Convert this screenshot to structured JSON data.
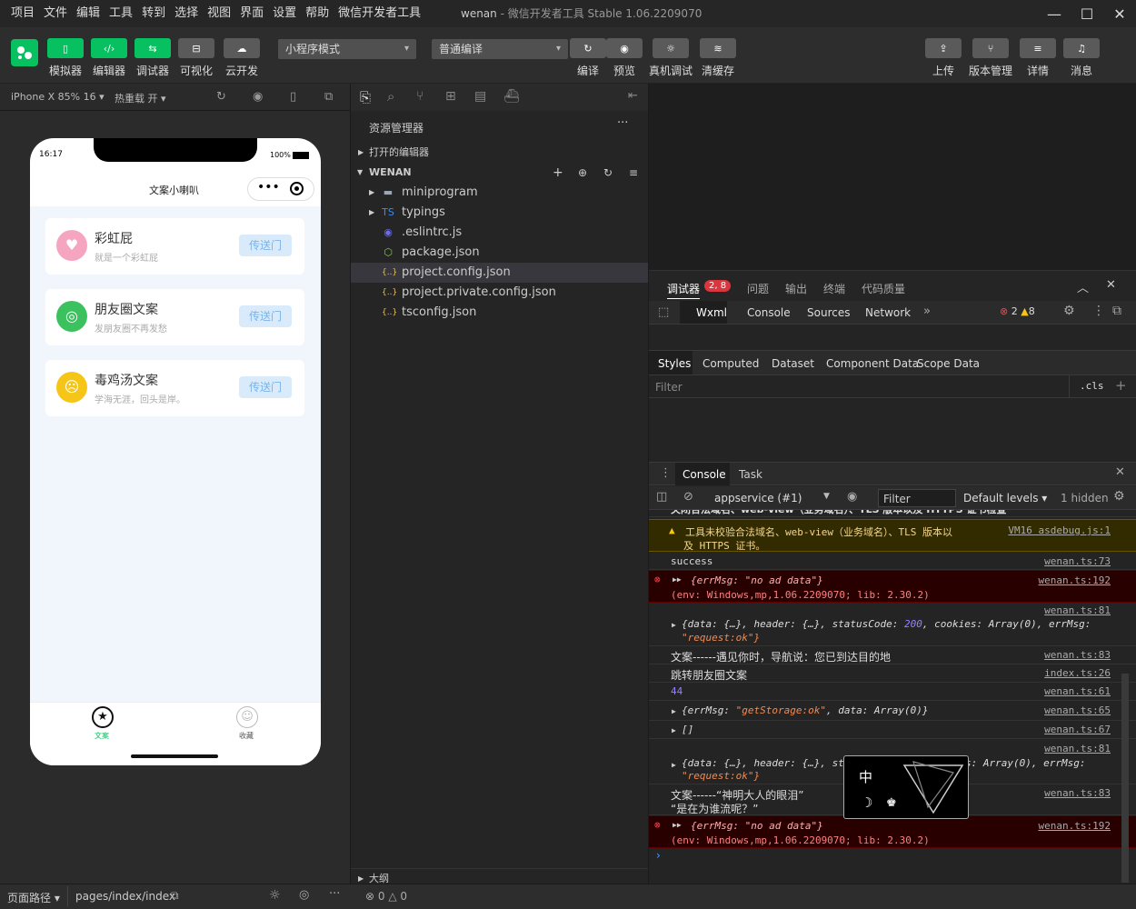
{
  "menubar": {
    "items": [
      "项目",
      "文件",
      "编辑",
      "工具",
      "转到",
      "选择",
      "视图",
      "界面",
      "设置",
      "帮助",
      "微信开发者工具"
    ],
    "title_app": "wenan",
    "title_rest": " - 微信开发者工具 Stable 1.06.2209070"
  },
  "toolbar": {
    "left": [
      {
        "label": "模拟器",
        "icon": "phone-icon"
      },
      {
        "label": "编辑器",
        "icon": "code-icon"
      },
      {
        "label": "调试器",
        "icon": "debug-icon"
      },
      {
        "label": "可视化",
        "icon": "layout-icon"
      },
      {
        "label": "云开发",
        "icon": "cloud-icon"
      }
    ],
    "mode_select": "小程序模式",
    "compile_select": "普通编译",
    "mid": [
      {
        "label": "编译",
        "icon": "refresh-icon"
      },
      {
        "label": "预览",
        "icon": "eye-icon"
      },
      {
        "label": "真机调试",
        "icon": "bug-icon"
      },
      {
        "label": "清缓存",
        "icon": "layers-icon"
      }
    ],
    "right": [
      {
        "label": "上传",
        "icon": "upload-icon"
      },
      {
        "label": "版本管理",
        "icon": "branch-icon"
      },
      {
        "label": "详情",
        "icon": "menu-icon"
      },
      {
        "label": "消息",
        "icon": "bell-icon"
      }
    ]
  },
  "simbar": {
    "device": "iPhone X 85% 16",
    "hotreload": "热重载 开"
  },
  "phone": {
    "time": "16:17",
    "battery": "100%",
    "nav_title": "文案小喇叭",
    "cards": [
      {
        "title": "彩虹屁",
        "sub": "就是一个彩虹屁",
        "btn": "传送门",
        "color": "#f6a5c0"
      },
      {
        "title": "朋友圈文案",
        "sub": "发朋友圈不再发愁",
        "btn": "传送门",
        "color": "#3cc15f"
      },
      {
        "title": "毒鸡汤文案",
        "sub": "学海无涯，回头是岸。",
        "btn": "传送门",
        "color": "#f5c518"
      }
    ],
    "tabs": [
      {
        "label": "文案",
        "active": true
      },
      {
        "label": "收藏",
        "active": false
      }
    ]
  },
  "explorer": {
    "title": "资源管理器",
    "open_editors": "打开的编辑器",
    "project": "WENAN",
    "files": [
      {
        "name": "miniprogram",
        "type": "folder"
      },
      {
        "name": "typings",
        "type": "ts-folder"
      },
      {
        "name": ".eslintrc.js",
        "type": "eslint"
      },
      {
        "name": "package.json",
        "type": "npm"
      },
      {
        "name": "project.config.json",
        "type": "json",
        "selected": true
      },
      {
        "name": "project.private.config.json",
        "type": "json"
      },
      {
        "name": "tsconfig.json",
        "type": "json"
      }
    ],
    "outline": "大纲"
  },
  "devtools": {
    "top_tabs": [
      "调试器",
      "问题",
      "输出",
      "终端",
      "代码质量"
    ],
    "badge": "2, 8",
    "panel_tabs": [
      "Wxml",
      "Console",
      "Sources",
      "Network"
    ],
    "err_count": "2",
    "warn_count": "8",
    "style_tabs": [
      "Styles",
      "Computed",
      "Dataset",
      "Component Data",
      "Scope Data"
    ],
    "filter_placeholder": "Filter",
    "cls": ".cls",
    "drawer_tabs": [
      "Console",
      "Task"
    ],
    "context": "appservice (#1)",
    "filter2": "Filter",
    "levels": "Default levels",
    "hidden": "1 hidden"
  },
  "console": {
    "cut_text": "关闭合法域名、web-view（业务域名）、TLS 版本以及 HTTPS 证书检查",
    "warn_line1": "工具未校验合法域名、web-view（业务域名）、TLS 版本以",
    "warn_line2": "及 HTTPS 证书。",
    "warn_src": "VM16 asdebug.js:1",
    "success": "success",
    "src_73": "wenan.ts:73",
    "err1": "{errMsg: \"no ad data\"}",
    "err_env": "(env: Windows,mp,1.06.2209070; lib: 2.30.2)",
    "src_192": "wenan.ts:192",
    "src_81": "wenan.ts:81",
    "req_line1_a": "{data: {…}, header: {…}, statusCode: ",
    "req_status": "200",
    "req_line1_b": ", cookies: Array(0), errMsg:",
    "req_line2": "\"request:ok\"}",
    "wenan1": "文案------遇见你时，导航说：您已到达目的地",
    "src_83": "wenan.ts:83",
    "jump": "跳转朋友圈文案",
    "src_index": "index.ts:26",
    "num44": "44",
    "src_61": "wenan.ts:61",
    "storage_a": "{errMsg: ",
    "storage_str": "\"getStorage:ok\"",
    "storage_b": ", data: Array(0)}",
    "src_65": "wenan.ts:65",
    "empty_arr": "[]",
    "src_67": "wenan.ts:67",
    "req2_a": "{data: {…}, header: {…}, st",
    "req2_b": "s: Array(0), errMsg:",
    "wenan2_l1": "文案------“神明大人的眼泪”",
    "wenan2_l2": "“是在为谁流呢？”",
    "err2": "{errMsg: \"no ad data\"}"
  },
  "ime": {
    "char": "中"
  },
  "statusbar": {
    "path_label": "页面路径",
    "path": "pages/index/index",
    "errors": "0",
    "warnings": "0"
  }
}
